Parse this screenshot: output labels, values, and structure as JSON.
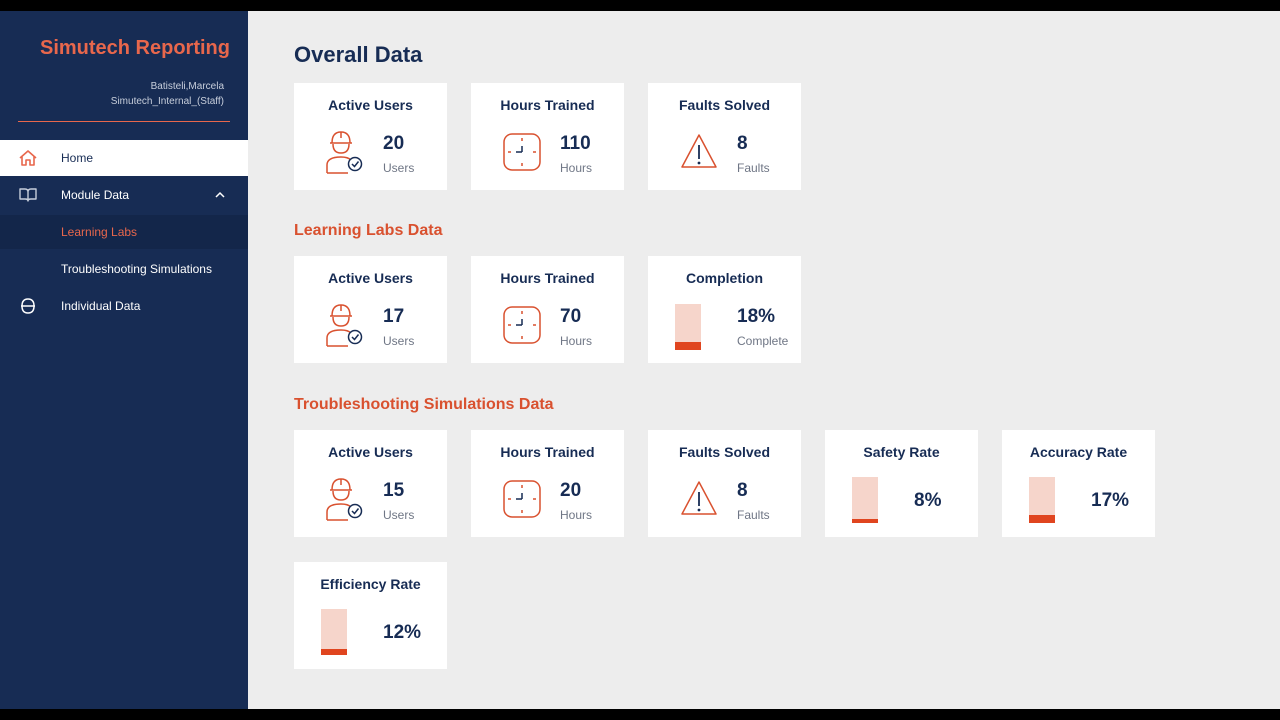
{
  "sidebar": {
    "brand": "Simutech Reporting",
    "user_name": "Batisteli,Marcela",
    "user_org": "Simutech_Internal_(Staff)",
    "nav": {
      "home": "Home",
      "module_data": "Module Data",
      "learning_labs": "Learning Labs",
      "troubleshooting": "Troubleshooting Simulations",
      "individual": "Individual Data"
    }
  },
  "overall": {
    "title": "Overall Data",
    "cards": [
      {
        "title": "Active Users",
        "value": "20",
        "unit": "Users",
        "icon": "worker-icon"
      },
      {
        "title": "Hours Trained",
        "value": "110",
        "unit": "Hours",
        "icon": "clock-icon"
      },
      {
        "title": "Faults Solved",
        "value": "8",
        "unit": "Faults",
        "icon": "warning-icon"
      }
    ]
  },
  "learning_labs": {
    "title": "Learning Labs Data",
    "cards": [
      {
        "title": "Active Users",
        "value": "17",
        "unit": "Users",
        "icon": "worker-icon"
      },
      {
        "title": "Hours Trained",
        "value": "70",
        "unit": "Hours",
        "icon": "clock-icon"
      },
      {
        "title": "Completion",
        "value": "18%",
        "unit": "Complete",
        "fraction": 0.18
      }
    ]
  },
  "troubleshooting": {
    "title": "Troubleshooting Simulations Data",
    "cards": [
      {
        "title": "Active Users",
        "value": "15",
        "unit": "Users",
        "icon": "worker-icon"
      },
      {
        "title": "Hours Trained",
        "value": "20",
        "unit": "Hours",
        "icon": "clock-icon"
      },
      {
        "title": "Faults Solved",
        "value": "8",
        "unit": "Faults",
        "icon": "warning-icon"
      },
      {
        "title": "Safety Rate",
        "value": "8%",
        "fraction": 0.08
      },
      {
        "title": "Accuracy Rate",
        "value": "17%",
        "fraction": 0.17
      },
      {
        "title": "Efficiency Rate",
        "value": "12%",
        "fraction": 0.12
      }
    ]
  },
  "colors": {
    "sidebar": "#172c54",
    "accent": "#e8674c",
    "bar_track": "#f6d5cb",
    "bar_fill": "#e0451f",
    "background": "#ededed"
  }
}
